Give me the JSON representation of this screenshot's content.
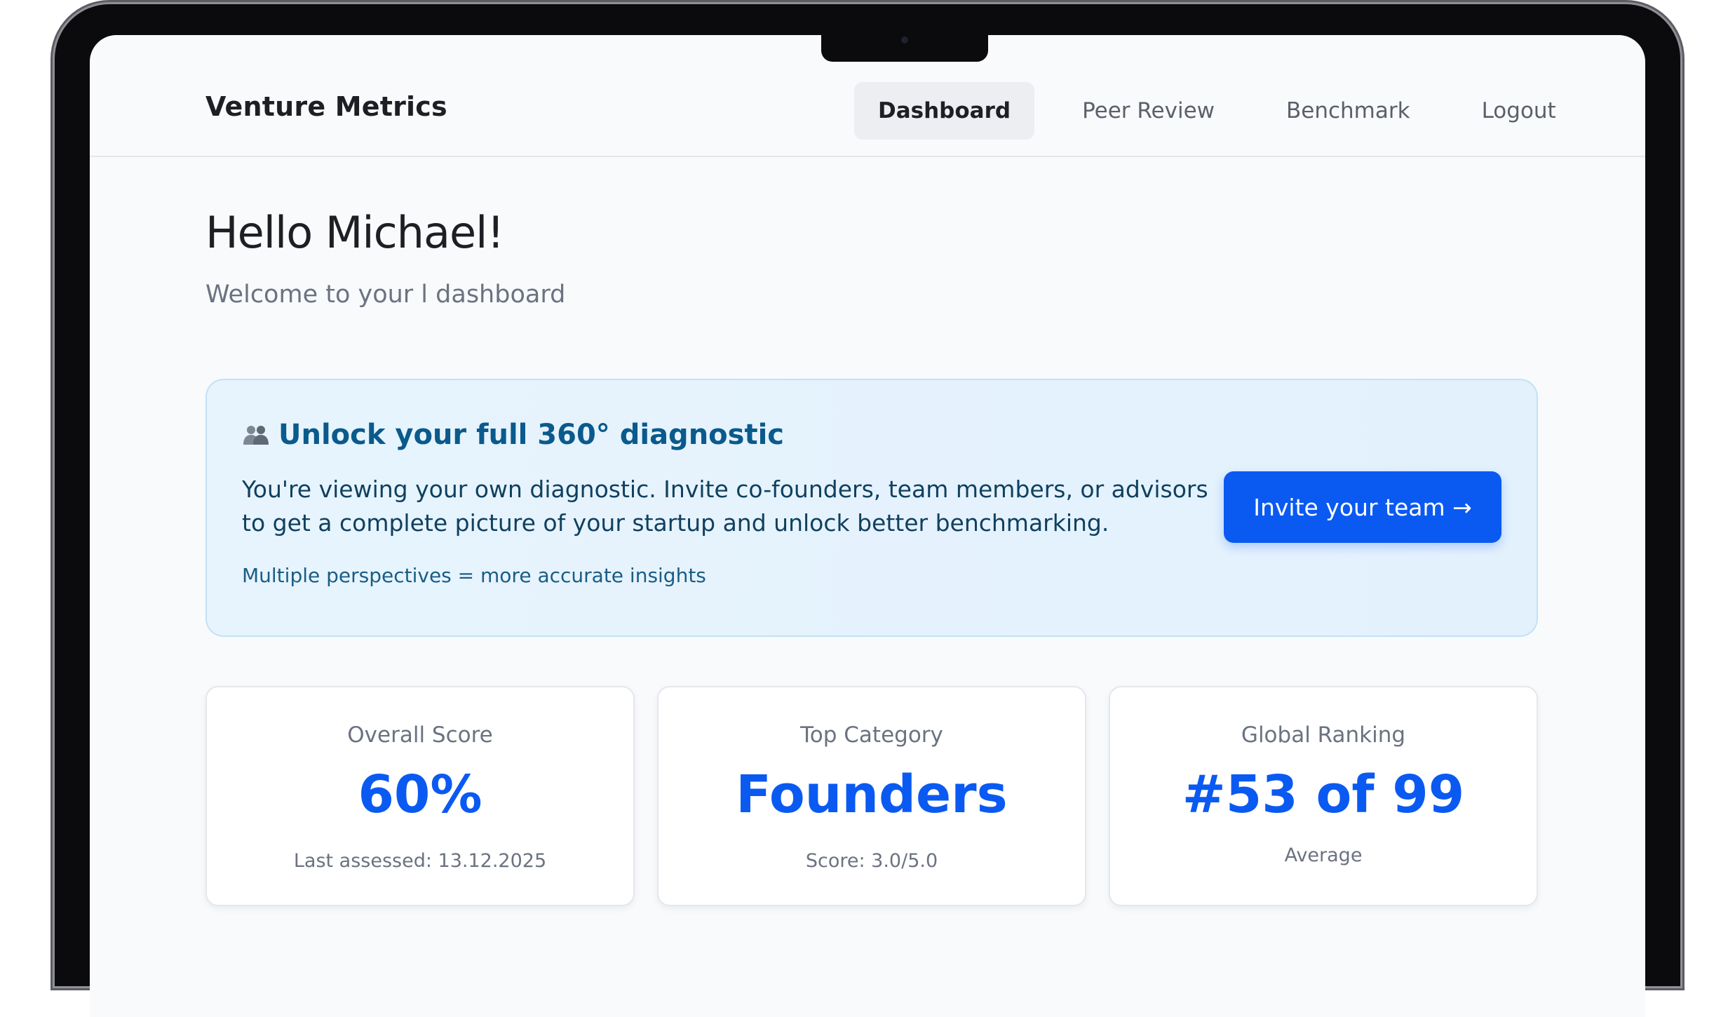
{
  "app": {
    "brand": "Venture Metrics"
  },
  "nav": {
    "items": [
      {
        "label": "Dashboard",
        "active": true
      },
      {
        "label": "Peer Review",
        "active": false
      },
      {
        "label": "Benchmark",
        "active": false
      },
      {
        "label": "Logout",
        "active": false
      }
    ]
  },
  "header": {
    "greeting": "Hello Michael!",
    "subtitle": "Welcome to your l dashboard"
  },
  "banner": {
    "icon": "people-icon",
    "title": "Unlock your full 360° diagnostic",
    "text": "You're viewing your own diagnostic. Invite co-founders, team members, or advisors to get a complete picture of your startup and unlock better benchmarking.",
    "note": "Multiple perspectives = more accurate insights",
    "button_label": "Invite your team →"
  },
  "stats": [
    {
      "label": "Overall Score",
      "value": "60%",
      "sub": "Last assessed: 13.12.2025"
    },
    {
      "label": "Top Category",
      "value": "Founders",
      "sub": "Score: 3.0/5.0"
    },
    {
      "label": "Global Ranking",
      "value": "#53 of 99",
      "sub": "Average"
    }
  ],
  "colors": {
    "accent": "#0a5af2",
    "banner_title": "#0a5a8c",
    "banner_bg": "#e7f4fd",
    "banner_border": "#bfe2f7"
  }
}
